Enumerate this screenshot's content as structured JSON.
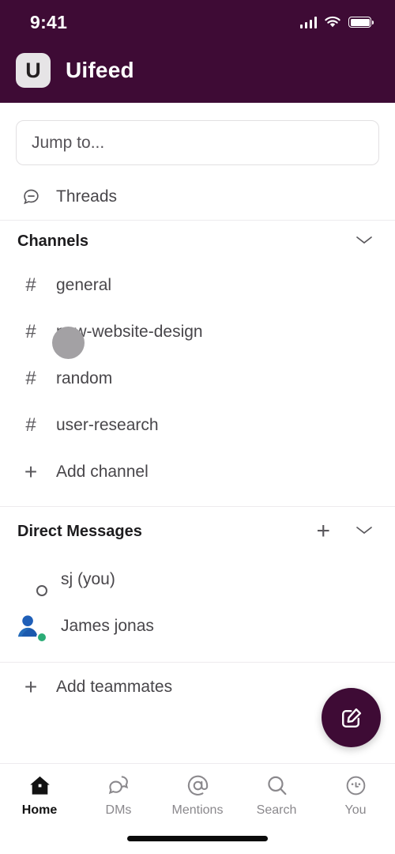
{
  "status_bar": {
    "time": "9:41",
    "icons": [
      "cellular-signal-icon",
      "wifi-icon",
      "battery-icon"
    ]
  },
  "header": {
    "logo_letter": "U",
    "workspace_name": "Uifeed",
    "background_color": "#3E0B35"
  },
  "search": {
    "placeholder": "Jump to...",
    "value": ""
  },
  "threads": {
    "label": "Threads",
    "icon": "thread-bubble-icon"
  },
  "channels_section": {
    "title": "Channels",
    "collapse_icon": "chevron-down-icon",
    "items": [
      {
        "label": "general",
        "icon": "hash-icon"
      },
      {
        "label": "new-website-design",
        "icon": "hash-icon"
      },
      {
        "label": "random",
        "icon": "hash-icon"
      },
      {
        "label": "user-research",
        "icon": "hash-icon"
      }
    ],
    "add_label": "Add channel",
    "add_icon": "plus-icon"
  },
  "direct_messages_section": {
    "title": "Direct Messages",
    "add_icon": "plus-icon",
    "collapse_icon": "chevron-down-icon",
    "items": [
      {
        "name": "sj (you)",
        "avatar": "photo-avatar",
        "presence": "away"
      },
      {
        "name": "James jonas",
        "avatar": "person-icon-avatar",
        "presence": "online"
      }
    ],
    "add_label": "Add teammates",
    "add_icon_bottom": "plus-icon"
  },
  "compose_button": {
    "icon": "compose-pencil-icon",
    "color": "#3E0B35"
  },
  "tabbar": {
    "items": [
      {
        "label": "Home",
        "icon": "home-icon",
        "active": true
      },
      {
        "label": "DMs",
        "icon": "chat-bubbles-icon",
        "active": false
      },
      {
        "label": "Mentions",
        "icon": "at-sign-icon",
        "active": false
      },
      {
        "label": "Search",
        "icon": "magnifier-icon",
        "active": false
      },
      {
        "label": "You",
        "icon": "face-avatar-icon",
        "active": false
      }
    ]
  },
  "touch_indicator": {
    "name": "touch-point"
  }
}
